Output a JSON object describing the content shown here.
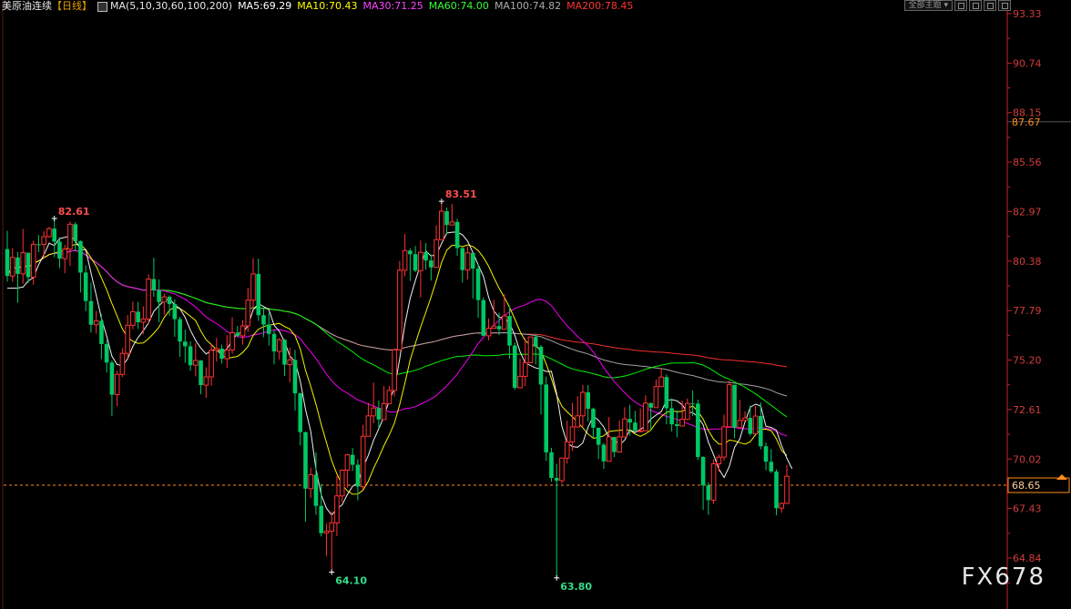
{
  "header": {
    "instrument": "美原油连续",
    "period": "【日线】",
    "ma_label": "MA(5,10,30,60,100,200)",
    "ma5": "MA5:69.29",
    "ma10": "MA10:70.43",
    "ma30": "MA30:71.25",
    "ma60": "MA60:74.00",
    "ma100": "MA100:74.82",
    "ma200": "MA200:78.45",
    "main_indicator_button": "全部主题"
  },
  "watermark": "FX678",
  "colors": {
    "up": "#ff3232",
    "down": "#00c864",
    "ma5": "#ffffff",
    "ma10": "#ffff00",
    "ma30": "#ff00ff",
    "ma60": "#00ff00",
    "ma100": "#aaaaaa",
    "ma200": "#ff3232",
    "axis": "#cc2222",
    "last_price": "#ff8c1a"
  },
  "chart_data": {
    "type": "candlestick",
    "title": "美原油连续【日线】",
    "ylim": [
      63.5,
      93.8
    ],
    "y_ticks": [
      "93.33",
      "90.74",
      "88.15",
      "85.56",
      "82.97",
      "80.38",
      "77.79",
      "75.20",
      "72.61",
      "70.02",
      "67.43",
      "64.84"
    ],
    "last_price": "68.65",
    "cursor_price": "87.67",
    "annotations": [
      {
        "label": "82.61",
        "index": 9,
        "kind": "high"
      },
      {
        "label": "83.51",
        "index": 83,
        "kind": "high"
      },
      {
        "label": "64.10",
        "index": 62,
        "kind": "low"
      },
      {
        "label": "63.80",
        "index": 105,
        "kind": "low"
      }
    ],
    "candles": [
      [
        81.01,
        79.6,
        81.96,
        79.3
      ],
      [
        79.6,
        80.57,
        81.06,
        79.3
      ],
      [
        80.57,
        79.71,
        80.85,
        78.2
      ],
      [
        79.71,
        80.82,
        82.06,
        79.2
      ],
      [
        80.82,
        79.54,
        80.78,
        79.23
      ],
      [
        79.54,
        81.26,
        81.46,
        79.14
      ],
      [
        81.26,
        81.25,
        81.74,
        80.85
      ],
      [
        81.25,
        81.66,
        81.95,
        80.54
      ],
      [
        81.66,
        82.08,
        82.17,
        81.61
      ],
      [
        82.08,
        81.4,
        82.61,
        80.59
      ],
      [
        81.4,
        80.51,
        81.64,
        80.01
      ],
      [
        80.51,
        81.01,
        81.23,
        79.75
      ],
      [
        81.01,
        82.31,
        82.45,
        80.13
      ],
      [
        82.31,
        81.42,
        82.42,
        80.95
      ],
      [
        81.42,
        79.78,
        81.46,
        78.74
      ],
      [
        79.78,
        78.29,
        80.15,
        77.76
      ],
      [
        78.29,
        77.05,
        79.25,
        76.63
      ],
      [
        77.05,
        77.25,
        77.78,
        76.59
      ],
      [
        77.25,
        76.04,
        77.6,
        75.25
      ],
      [
        76.04,
        75.07,
        76.24,
        74.55
      ],
      [
        75.07,
        73.39,
        75.18,
        72.26
      ],
      [
        73.39,
        74.45,
        74.64,
        72.79
      ],
      [
        74.45,
        75.55,
        75.82,
        74.31
      ],
      [
        75.55,
        77.02,
        77.55,
        75.28
      ],
      [
        77.02,
        77.73,
        78.25,
        76.81
      ],
      [
        77.73,
        77.18,
        78.24,
        76.83
      ],
      [
        77.18,
        77.35,
        78.01,
        76.55
      ],
      [
        77.35,
        79.44,
        79.68,
        77.09
      ],
      [
        79.44,
        78.85,
        80.56,
        78.51
      ],
      [
        78.85,
        78.24,
        79.42,
        77.18
      ],
      [
        78.24,
        78.51,
        78.67,
        77.58
      ],
      [
        78.51,
        78.13,
        78.59,
        77.52
      ],
      [
        78.13,
        77.34,
        78.38,
        76.42
      ],
      [
        77.34,
        76.17,
        77.46,
        75.37
      ],
      [
        76.17,
        75.92,
        76.79,
        75.05
      ],
      [
        75.92,
        74.93,
        76.18,
        74.64
      ],
      [
        74.93,
        75.18,
        76.08,
        74.35
      ],
      [
        75.18,
        73.89,
        75.19,
        73.41
      ],
      [
        73.89,
        74.32,
        74.82,
        73.22
      ],
      [
        74.32,
        75.71,
        76.05,
        73.86
      ],
      [
        75.71,
        75.8,
        76.36,
        75.12
      ],
      [
        75.8,
        75.27,
        76.01,
        75.02
      ],
      [
        75.27,
        75.73,
        76.5,
        74.8
      ],
      [
        75.73,
        76.63,
        77.45,
        75.55
      ],
      [
        76.63,
        76.47,
        76.99,
        76.39
      ],
      [
        76.47,
        76.99,
        77.29,
        76.01
      ],
      [
        76.99,
        78.33,
        78.97,
        76.66
      ],
      [
        78.33,
        79.71,
        80.53,
        77.88
      ],
      [
        79.71,
        77.55,
        80.51,
        77.25
      ],
      [
        77.55,
        77.06,
        77.95,
        76.4
      ],
      [
        77.06,
        76.57,
        77.69,
        75.96
      ],
      [
        76.57,
        75.65,
        76.77,
        74.97
      ],
      [
        75.65,
        76.26,
        76.35,
        75.23
      ],
      [
        76.26,
        74.96,
        76.3,
        74.36
      ],
      [
        74.96,
        75.21,
        75.84,
        74.03
      ],
      [
        75.21,
        73.46,
        75.73,
        72.56
      ],
      [
        73.46,
        71.43,
        73.5,
        70.73
      ],
      [
        71.43,
        68.47,
        71.45,
        66.74
      ],
      [
        68.47,
        69.2,
        69.57,
        67.98
      ],
      [
        69.2,
        67.57,
        70.37,
        67.1
      ],
      [
        67.57,
        66.14,
        68.72,
        65.97
      ],
      [
        66.14,
        66.24,
        66.64,
        64.94
      ],
      [
        66.24,
        66.68,
        67.29,
        64.1
      ],
      [
        66.68,
        68.09,
        69.14,
        65.99
      ],
      [
        68.09,
        69.44,
        69.48,
        67.77
      ],
      [
        69.44,
        70.24,
        70.29,
        68.52
      ],
      [
        70.24,
        69.72,
        70.6,
        69.4
      ],
      [
        69.72,
        68.58,
        70.01,
        67.86
      ],
      [
        68.58,
        71.21,
        71.81,
        68.42
      ],
      [
        71.21,
        72.28,
        72.96,
        71.34
      ],
      [
        72.28,
        72.69,
        74.02,
        71.89
      ],
      [
        72.69,
        72.09,
        73.08,
        71.64
      ],
      [
        72.09,
        72.92,
        73.84,
        72.1
      ],
      [
        72.92,
        73.61,
        73.85,
        73.15
      ],
      [
        73.61,
        75.73,
        75.81,
        73.29
      ],
      [
        75.73,
        79.9,
        80.39,
        75.69
      ],
      [
        79.9,
        80.93,
        81.8,
        79.58
      ],
      [
        80.93,
        80.74,
        81.05,
        79.34
      ],
      [
        80.74,
        79.88,
        81.17,
        79.8
      ],
      [
        79.88,
        80.84,
        81.46,
        78.48
      ],
      [
        80.84,
        80.41,
        81.32,
        79.93
      ],
      [
        80.41,
        80.05,
        80.73,
        79.36
      ],
      [
        80.05,
        81.5,
        82.25,
        80.11
      ],
      [
        81.5,
        82.99,
        83.51,
        81.78
      ],
      [
        82.99,
        82.27,
        83.18,
        81.77
      ],
      [
        82.27,
        82.43,
        83.37,
        82.32
      ],
      [
        82.43,
        81.06,
        82.6,
        80.66
      ],
      [
        81.06,
        79.91,
        81.1,
        79.26
      ],
      [
        79.91,
        80.81,
        81.14,
        79.42
      ],
      [
        80.81,
        79.99,
        80.67,
        78.42
      ],
      [
        79.99,
        78.34,
        80.25,
        77.41
      ],
      [
        78.34,
        76.47,
        78.48,
        76.46
      ],
      [
        76.47,
        76.86,
        77.37,
        76.23
      ],
      [
        76.86,
        76.98,
        78.35,
        76.91
      ],
      [
        76.98,
        76.81,
        77.68,
        76.51
      ],
      [
        76.81,
        77.51,
        78.65,
        77.39
      ],
      [
        77.51,
        75.96,
        78.04,
        75.27
      ],
      [
        75.96,
        73.75,
        76.12,
        73.64
      ],
      [
        73.75,
        74.35,
        75.29,
        73.72
      ],
      [
        74.35,
        75.06,
        76.35,
        73.84
      ],
      [
        75.06,
        76.41,
        76.35,
        75.48
      ],
      [
        76.41,
        75.9,
        76.58,
        74.97
      ],
      [
        75.9,
        73.92,
        75.98,
        72.35
      ],
      [
        73.92,
        70.37,
        74.33,
        69.92
      ],
      [
        70.37,
        69.03,
        70.61,
        68.84
      ],
      [
        69.03,
        68.89,
        69.77,
        63.8
      ],
      [
        68.89,
        70.07,
        70.1,
        68.73
      ],
      [
        70.07,
        70.92,
        72.03,
        69.78
      ],
      [
        70.92,
        71.7,
        72.96,
        70.44
      ],
      [
        71.7,
        72.28,
        73.31,
        71.66
      ],
      [
        72.28,
        73.51,
        73.89,
        71.7
      ],
      [
        73.51,
        72.65,
        73.89,
        71.98
      ],
      [
        72.65,
        71.66,
        72.71,
        71.13
      ],
      [
        71.66,
        70.77,
        71.17,
        70.02
      ],
      [
        70.77,
        69.9,
        70.87,
        69.51
      ],
      [
        69.9,
        71.18,
        72.22,
        70.42
      ],
      [
        71.18,
        70.39,
        70.68,
        70.12
      ],
      [
        70.39,
        71.18,
        72.04,
        71.04
      ],
      [
        71.18,
        72.12,
        72.73,
        72.11
      ],
      [
        72.12,
        71.93,
        72.86,
        71.25
      ],
      [
        71.93,
        71.49,
        72.54,
        71.49
      ],
      [
        71.49,
        71.5,
        72.67,
        71.45
      ],
      [
        71.5,
        72.95,
        73.36,
        71.61
      ],
      [
        72.95,
        72.71,
        72.97,
        71.54
      ],
      [
        72.71,
        73.81,
        74.18,
        73.05
      ],
      [
        73.81,
        74.31,
        74.79,
        73.8
      ],
      [
        74.31,
        72.68,
        74.45,
        71.84
      ],
      [
        72.68,
        71.84,
        73.2,
        71.46
      ],
      [
        71.84,
        71.75,
        72.57,
        71.15
      ],
      [
        71.75,
        72.1,
        73.08,
        71.82
      ],
      [
        72.1,
        72.93,
        73.19,
        72.06
      ],
      [
        72.93,
        72.92,
        73.6,
        72.27
      ],
      [
        72.92,
        70.13,
        73.13,
        69.97
      ],
      [
        70.13,
        68.64,
        70.16,
        67.36
      ],
      [
        68.64,
        67.87,
        68.79,
        67.1
      ],
      [
        67.87,
        69.77,
        69.99,
        67.68
      ],
      [
        69.77,
        70.12,
        70.26,
        69.36
      ],
      [
        70.12,
        71.71,
        72.35,
        69.93
      ],
      [
        71.71,
        73.91,
        74.13,
        71.73
      ],
      [
        73.91,
        71.67,
        73.85,
        71.1
      ],
      [
        71.67,
        72.04,
        73.12,
        71.65
      ],
      [
        72.04,
        72.17,
        72.52,
        72.07
      ],
      [
        72.17,
        71.34,
        72.83,
        71.24
      ],
      [
        71.34,
        72.27,
        72.79,
        71.41
      ],
      [
        72.27,
        70.69,
        72.98,
        70.53
      ],
      [
        70.69,
        69.88,
        70.88,
        69.43
      ],
      [
        69.88,
        69.37,
        70.54,
        69.28
      ],
      [
        69.37,
        67.45,
        69.48,
        67.08
      ],
      [
        67.45,
        67.7,
        67.76,
        67.22
      ],
      [
        67.7,
        69.12,
        69.71,
        67.67
      ]
    ],
    "ma": {
      "ma5": [
        78.96,
        78.96,
        78.97,
        79.02,
        79.34,
        79.52,
        80.2,
        80.71,
        81.32,
        81.19,
        81.56,
        81.62,
        81.7,
        81.45,
        81.0,
        80.96,
        79.77,
        78.59,
        77.39,
        76.44,
        75.4,
        74.97,
        74.9,
        75.26,
        75.92,
        76.38,
        76.74,
        77.14,
        77.75,
        78.05,
        78.31,
        78.4,
        78.1,
        77.89,
        77.43,
        76.76,
        76.23,
        75.82,
        75.52,
        75.7,
        75.79,
        75.6,
        75.79,
        76.24,
        76.61,
        76.61,
        77.01,
        77.83,
        78.15,
        78.0,
        77.85,
        77.02,
        76.71,
        76.15,
        75.41,
        75.13,
        74.1,
        72.61,
        71.47,
        69.48,
        68.15,
        67.45,
        67.09,
        67.41,
        67.62,
        68.16,
        68.6,
        68.76,
        69.58,
        70.21,
        70.99,
        71.61,
        72.24,
        73.09,
        73.7,
        75.28,
        77.08,
        78.44,
        79.36,
        80.22,
        80.91,
        80.65,
        80.71,
        81.29,
        81.85,
        81.89,
        81.9,
        81.76,
        81.42,
        80.83,
        80.19,
        79.59,
        78.49,
        77.76,
        77.44,
        77.4,
        77.13,
        76.5,
        75.64,
        75.04,
        74.92,
        74.79,
        74.73,
        74.6,
        74.61,
        73.45,
        71.73,
        70.87,
        70.67,
        70.64,
        70.86,
        71.68,
        72.27,
        72.05,
        71.7,
        71.13,
        71.04,
        70.76,
        71.01,
        71.55,
        71.41,
        71.57,
        71.75,
        72.11,
        72.32,
        72.5,
        73.09,
        73.13,
        73.07,
        72.86,
        72.48,
        72.45,
        72.24,
        71.81,
        70.91,
        70.24,
        69.5,
        69.05,
        69.63,
        70.64,
        71.07,
        71.96,
        72.73,
        72.89,
        72.8,
        71.74,
        71.67,
        71.53,
        70.71,
        70.06,
        69.51
      ]
    }
  }
}
